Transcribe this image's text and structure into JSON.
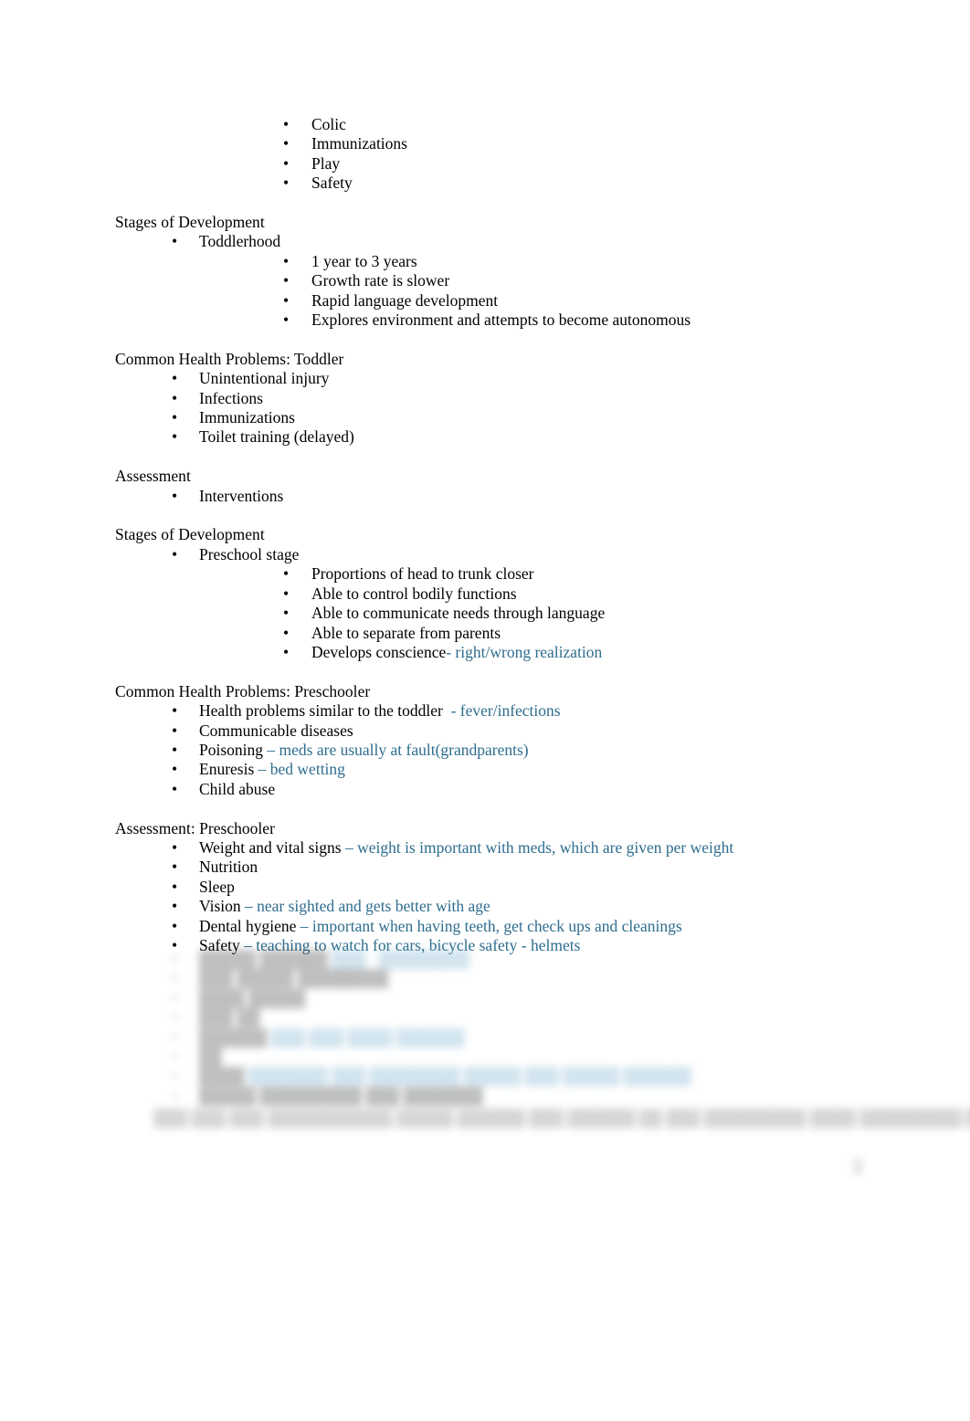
{
  "document": {
    "bullet_glyph": "•",
    "accent_color": "#2e6d8e",
    "text_color": "#000000",
    "background_color": "#ffffff"
  },
  "sections": {
    "infant_topics": {
      "items": [
        {
          "label": "Colic"
        },
        {
          "label": "Immunizations"
        },
        {
          "label": "Play"
        },
        {
          "label": "Safety"
        }
      ]
    },
    "stages_toddler": {
      "heading": "Stages of Development",
      "stage_label": "Toddlerhood",
      "items": [
        {
          "label": "1 year to 3 years"
        },
        {
          "label": "Growth rate is slower"
        },
        {
          "label": "Rapid language development"
        },
        {
          "label": "Explores environment and attempts to become autonomous"
        }
      ]
    },
    "problems_toddler": {
      "heading": "Common Health Problems: Toddler",
      "items": [
        {
          "label": "Unintentional injury"
        },
        {
          "label": "Infections"
        },
        {
          "label": "Immunizations"
        },
        {
          "label": "Toilet training (delayed)"
        }
      ]
    },
    "assessment_toddler": {
      "heading": "Assessment",
      "items": [
        {
          "label": "Interventions"
        }
      ]
    },
    "stages_preschool": {
      "heading": "Stages of Development",
      "stage_label": "Preschool stage",
      "items": [
        {
          "label": "Proportions of head to trunk closer",
          "note": ""
        },
        {
          "label": "Able to control bodily functions",
          "note": ""
        },
        {
          "label": "Able to communicate needs through language",
          "note": ""
        },
        {
          "label": "Able to separate from parents",
          "note": ""
        },
        {
          "label": "Develops conscience",
          "note": "- right/wrong realization"
        }
      ]
    },
    "problems_preschooler": {
      "heading": "Common Health Problems: Preschooler",
      "items": [
        {
          "label": "Health problems similar to the toddler  ",
          "note": "- fever/infections"
        },
        {
          "label": "Communicable diseases",
          "note": ""
        },
        {
          "label": "Poisoning ",
          "note": "– meds are usually at fault(grandparents)"
        },
        {
          "label": "Enuresis ",
          "note": "– bed wetting"
        },
        {
          "label": "Child abuse",
          "note": ""
        }
      ]
    },
    "assessment_preschooler": {
      "heading": "Assessment: Preschooler",
      "items": [
        {
          "label": "Weight and vital signs ",
          "note": "– weight is important with meds, which are given per weight"
        },
        {
          "label": "Nutrition",
          "note": ""
        },
        {
          "label": "Sleep",
          "note": ""
        },
        {
          "label": "Vision ",
          "note": "– near sighted and gets better with age"
        },
        {
          "label": "Dental hygiene ",
          "note": "– important when having teeth, get check ups and cleanings"
        },
        {
          "label": "Safety ",
          "note": "– teaching to watch for cars, bicycle safety - helmets"
        }
      ]
    },
    "obscured": {
      "items": [
        {
          "label": "█████ ██████ ",
          "note": "███ - ████████"
        },
        {
          "label": "███ █████ ████████",
          "note": ""
        },
        {
          "label": "████ █████",
          "note": ""
        },
        {
          "label": "███ ██",
          "note": ""
        },
        {
          "label": "██████ ",
          "note": "███ ███ ████ ██████"
        },
        {
          "label": "██",
          "note": ""
        },
        {
          "label": "████ ",
          "note": "███████ ███ ████████ █████ ███ █████ ██████"
        },
        {
          "label": "█████ █████████ ███ ███████",
          "note": ""
        }
      ],
      "footnote": "███ ███ ███ ███████████ █████ ██████ ███ ██████ ██ ███ █████████ ████ █████████ ██ ████",
      "page_mark": "█"
    }
  }
}
